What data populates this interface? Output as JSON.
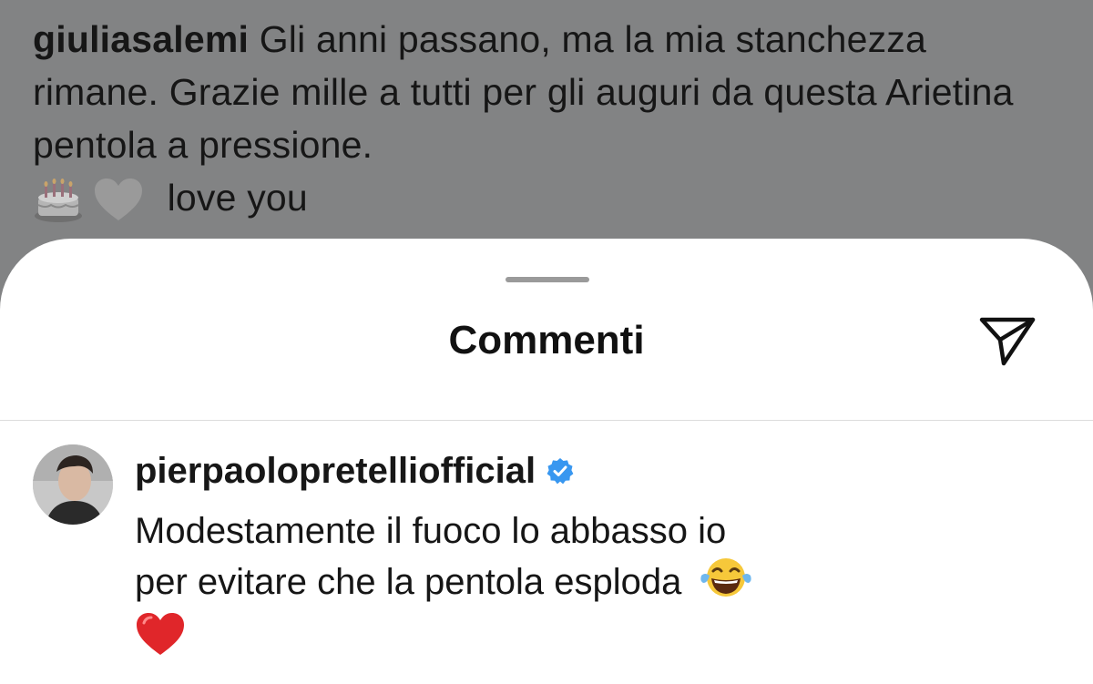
{
  "post": {
    "username": "giuliasalemi",
    "caption_text": "Gli anni passano, ma la mia stanchezza rimane. Grazie mille a tutti per gli auguri da questa Arietina pentola a pressione.",
    "caption_emojis": [
      "birthday-cake",
      "white-heart"
    ],
    "caption_tail": "love you"
  },
  "comments_sheet": {
    "title": "Commenti",
    "share_icon": "paper-plane-icon"
  },
  "comment": {
    "author": "pierpaolopretelliofficial",
    "verified": true,
    "text_line1": "Modestamente il fuoco lo abbasso io",
    "text_line2": "per evitare che la pentola esploda",
    "emojis": [
      "face-with-tears-of-joy",
      "red-heart"
    ]
  },
  "colors": {
    "backdrop": "#828384",
    "sheet": "#ffffff",
    "verified_badge": "#3897f0",
    "heart_red": "#e0262a"
  }
}
